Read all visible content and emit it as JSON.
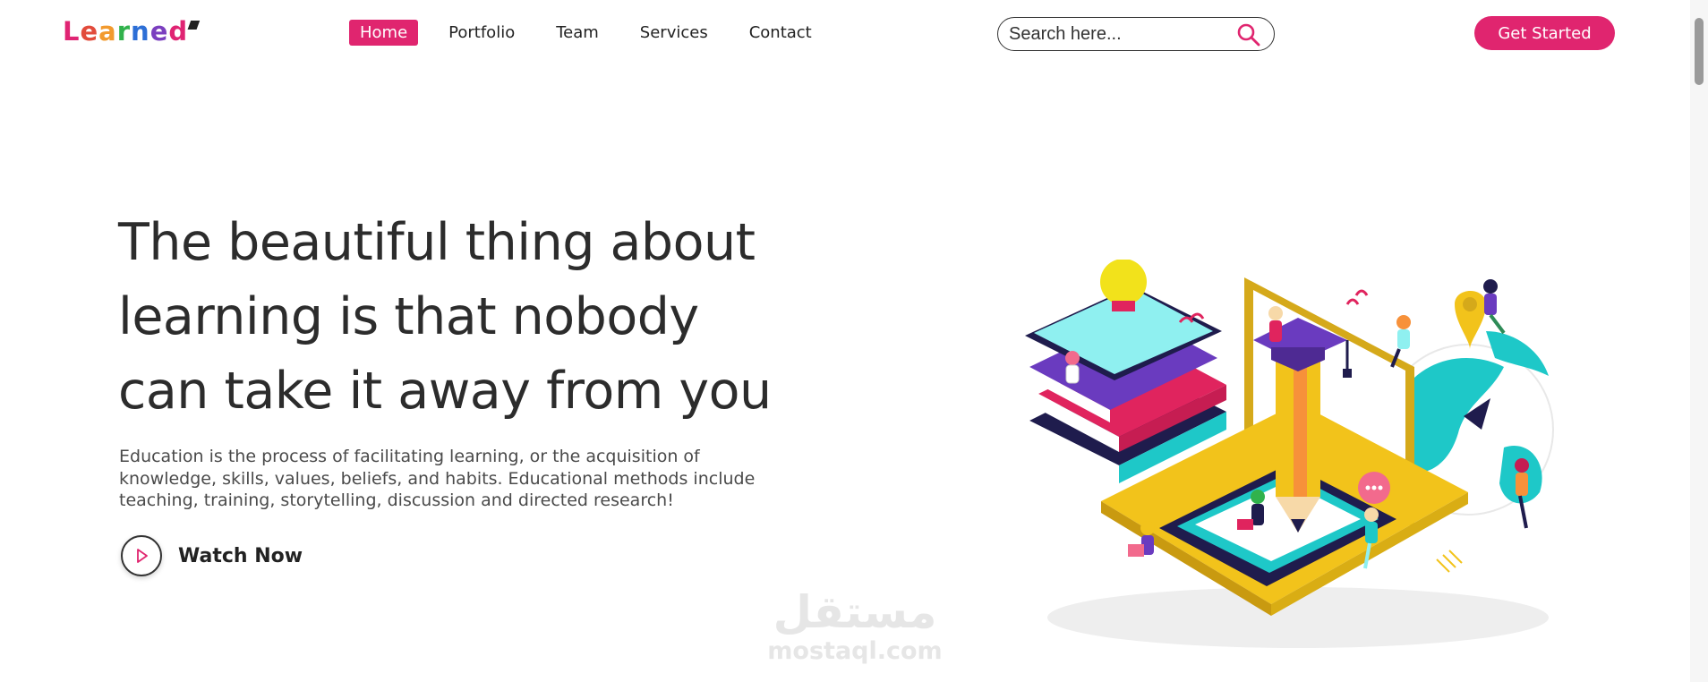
{
  "brand": {
    "logo_letters": [
      "L",
      "e",
      "a",
      "r",
      "n",
      "e",
      "d"
    ]
  },
  "nav": {
    "items": [
      {
        "label": "Home",
        "active": true
      },
      {
        "label": "Portfolio",
        "active": false
      },
      {
        "label": "Team",
        "active": false
      },
      {
        "label": "Services",
        "active": false
      },
      {
        "label": "Contact",
        "active": false
      }
    ]
  },
  "search": {
    "placeholder": "Search here...",
    "value": "",
    "icon": "search-icon"
  },
  "header": {
    "cta_label": "Get Started"
  },
  "hero": {
    "headline_lines": [
      "The beautiful thing about",
      "learning is that nobody",
      "can take it away from you"
    ],
    "description_lines": [
      "Education is the process of facilitating learning, or the acquisition of",
      "knowledge, skills, values, beliefs, and habits. Educational methods include",
      "teaching, training, storytelling, discussion and directed research!"
    ],
    "watch_label": "Watch Now",
    "watch_icon": "play-icon"
  },
  "watermark": {
    "arabic": "مستقل",
    "latin": "mostaql.com"
  },
  "colors": {
    "accent": "#e0256f",
    "text": "#2c2c2c",
    "illustration_yellow": "#f2c31b",
    "illustration_teal": "#1ec8c8",
    "illustration_navy": "#1f1c4d",
    "illustration_purple": "#6a3bbf"
  }
}
